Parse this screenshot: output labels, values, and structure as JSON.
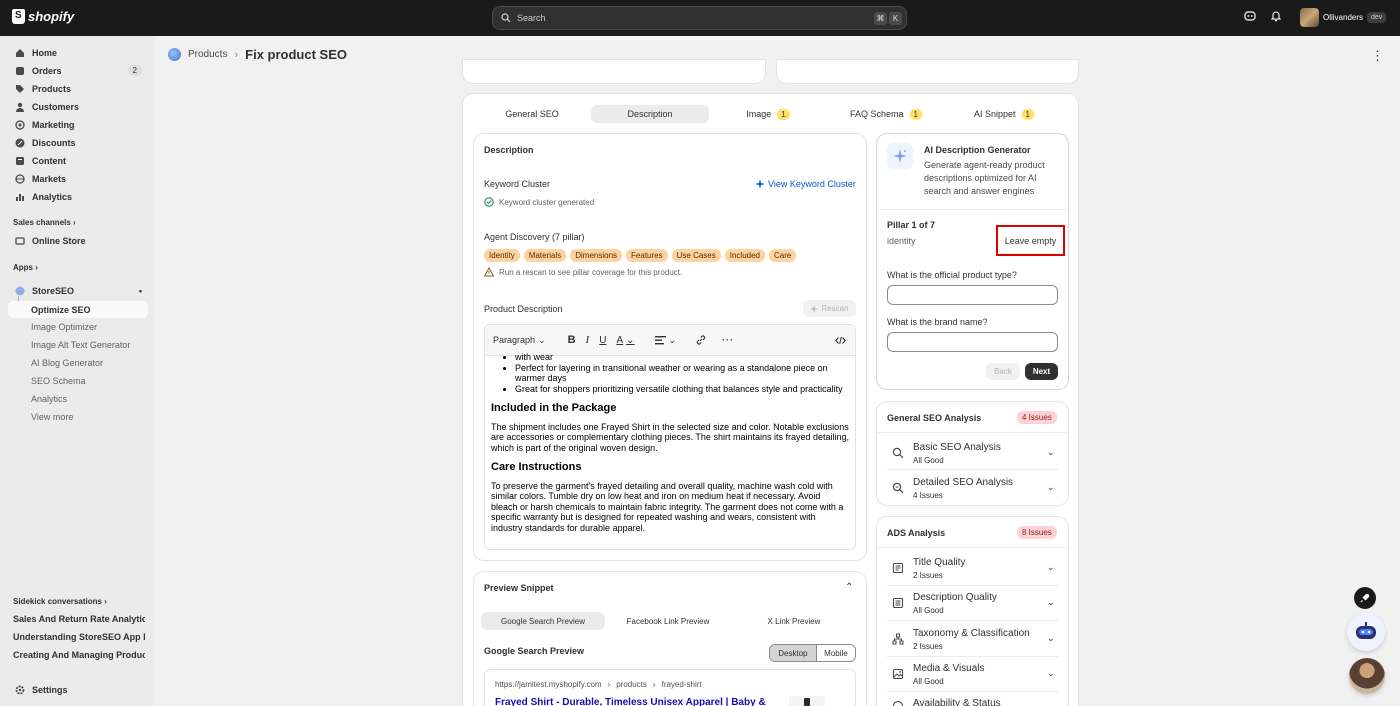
{
  "topbar": {
    "brand": "shopify",
    "search_placeholder": "Search",
    "shortcut_keys": [
      "⌘",
      "K"
    ],
    "store_name": "Ollivanders",
    "store_badge": "dev"
  },
  "sidebar": {
    "items": [
      {
        "label": "Home",
        "icon": "home-icon"
      },
      {
        "label": "Orders",
        "icon": "orders-icon",
        "badge": "2"
      },
      {
        "label": "Products",
        "icon": "tag-icon"
      },
      {
        "label": "Customers",
        "icon": "person-icon"
      },
      {
        "label": "Marketing",
        "icon": "target-icon"
      },
      {
        "label": "Discounts",
        "icon": "discount-icon"
      },
      {
        "label": "Content",
        "icon": "content-icon"
      },
      {
        "label": "Markets",
        "icon": "globe-icon"
      },
      {
        "label": "Analytics",
        "icon": "chart-icon"
      }
    ],
    "sales_channels_label": "Sales channels",
    "online_store": "Online Store",
    "apps_label": "Apps",
    "app_name": "StoreSEO",
    "app_items": [
      "Optimize SEO",
      "Image Optimizer",
      "Image Alt Text Generator",
      "AI Blog Generator",
      "SEO Schema",
      "Analytics",
      "View more"
    ],
    "sidekick_label": "Sidekick conversations",
    "conversations": [
      "Sales And Return Rate Analytics",
      "Understanding StoreSEO App Features",
      "Creating And Managing Products"
    ],
    "settings": "Settings"
  },
  "breadcrumb": {
    "parent": "Products",
    "title": "Fix product SEO"
  },
  "tabs": [
    {
      "label": "General SEO",
      "count": ""
    },
    {
      "label": "Description",
      "count": ""
    },
    {
      "label": "Image",
      "count": "1"
    },
    {
      "label": "FAQ Schema",
      "count": "1"
    },
    {
      "label": "AI Snippet",
      "count": "1"
    }
  ],
  "description": {
    "heading": "Description",
    "keyword_cluster_label": "Keyword Cluster",
    "view_cluster_link": "View Keyword Cluster",
    "cluster_status": "Keyword cluster generated",
    "agent_discovery_label": "Agent Discovery (7 pillar)",
    "pillars": [
      "Identity",
      "Materials",
      "Dimensions",
      "Features",
      "Use Cases",
      "Included",
      "Care"
    ],
    "rescan_warning": "Run a rescan to see pillar coverage for this product.",
    "product_description_label": "Product Description",
    "rescan_button": "Rescan",
    "toolbar_format": "Paragraph",
    "editor": {
      "bullet_0": "with wear",
      "bullet_1": "Perfect for layering in transitional weather or wearing as a standalone piece on warmer days",
      "bullet_2": "Great for shoppers prioritizing versatile clothing that balances style and practicality",
      "h_included": "Included in the Package",
      "p_included": "The shipment includes one Frayed Shirt in the selected size and color. Notable exclusions are accessories or complementary clothing pieces. The shirt maintains its frayed detailing, which is part of the original woven design.",
      "h_care": "Care Instructions",
      "p_care": "To preserve the garment's frayed detailing and overall quality, machine wash cold with similar colors. Tumble dry on low heat and iron on medium heat if necessary. Avoid bleach or harsh chemicals to maintain fabric integrity. The garment does not come with a specific warranty but is designed for repeated washing and wears, consistent with industry standards for durable apparel."
    }
  },
  "preview": {
    "heading": "Preview Snippet",
    "tabs": [
      "Google Search Preview",
      "Facebook Link Preview",
      "X Link Preview"
    ],
    "google_heading": "Google Search Preview",
    "device_tabs": [
      "Desktop",
      "Mobile"
    ],
    "url_domain": "https://jamitest.myshopify.com",
    "url_path_1": "products",
    "url_path_2": "frayed-shirt",
    "result_title": "Frayed Shirt - Durable, Timeless Unisex Apparel | Baby &"
  },
  "ai_generator": {
    "title": "AI Description Generator",
    "desc": "Generate agent-ready product descriptions optimized for AI search and answer engines",
    "pillar_progress": "Pillar 1 of 7",
    "pillar_name": "identity",
    "leave_empty": "Leave empty",
    "q1": "What is the official product type?",
    "q2": "What is the brand name?",
    "back": "Back",
    "next": "Next"
  },
  "general_seo": {
    "heading": "General SEO Analysis",
    "badge": "4 Issues",
    "rows": [
      {
        "title": "Basic SEO Analysis",
        "status": "All Good"
      },
      {
        "title": "Detailed SEO Analysis",
        "status": "4 Issues"
      }
    ]
  },
  "ads": {
    "heading": "ADS Analysis",
    "badge": "8 Issues",
    "rows": [
      {
        "title": "Title Quality",
        "status": "2 Issues"
      },
      {
        "title": "Description Quality",
        "status": "All Good"
      },
      {
        "title": "Taxonomy & Classification",
        "status": "2 Issues"
      },
      {
        "title": "Media & Visuals",
        "status": "All Good"
      },
      {
        "title": "Availability & Status",
        "status": ""
      }
    ]
  },
  "colors": {
    "accent": "#005bd3",
    "highlight_box": "#e00000",
    "pill_bg": "#fed3a0",
    "count_bg": "#ffe066",
    "issue_bg": "#fed1d7"
  }
}
